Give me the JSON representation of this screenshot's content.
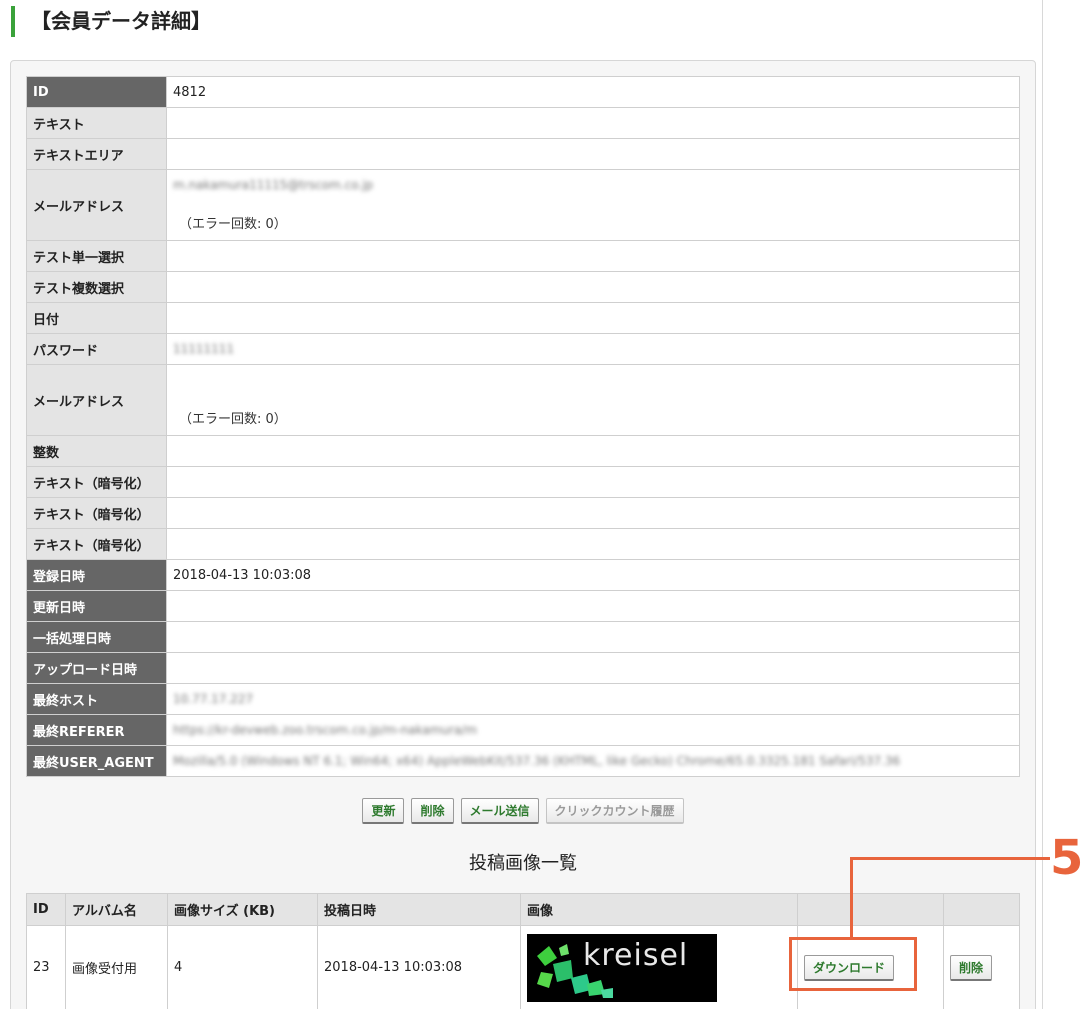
{
  "page": {
    "title": "【会員データ詳細】"
  },
  "detail": {
    "rows": [
      {
        "label": "ID",
        "value": "4812"
      },
      {
        "label": "テキスト",
        "value": ""
      },
      {
        "label": "テキストエリア",
        "value": ""
      },
      {
        "label": "メールアドレス",
        "value": "m.nakamura11115@trscom.co.jp",
        "note": "（エラー回数: 0）"
      },
      {
        "label": "テスト単一選択",
        "value": ""
      },
      {
        "label": "テスト複数選択",
        "value": ""
      },
      {
        "label": "日付",
        "value": ""
      },
      {
        "label": "パスワード",
        "value": "11111111"
      },
      {
        "label": "メールアドレス",
        "value": "",
        "note": "（エラー回数: 0）"
      },
      {
        "label": "整数",
        "value": ""
      },
      {
        "label": "テキスト（暗号化）",
        "value": ""
      },
      {
        "label": "テキスト（暗号化）",
        "value": ""
      },
      {
        "label": "テキスト（暗号化）",
        "value": ""
      },
      {
        "label": "登録日時",
        "value": "2018-04-13 10:03:08"
      },
      {
        "label": "更新日時",
        "value": ""
      },
      {
        "label": "一括処理日時",
        "value": ""
      },
      {
        "label": "アップロード日時",
        "value": ""
      },
      {
        "label": "最終ホスト",
        "value": "10.77.17.227"
      },
      {
        "label": "最終REFERER",
        "value": "https://kr-devweb.zoo.trscom.co.jp/m-nakamura/m"
      },
      {
        "label": "最終USER_AGENT",
        "value": "Mozilla/5.0 (Windows NT 6.1; Win64; x64) AppleWebKit/537.36 (KHTML, like Gecko) Chrome/65.0.3325.181 Safari/537.36"
      }
    ]
  },
  "actions": {
    "update": "更新",
    "delete": "削除",
    "send_mail": "メール送信",
    "click_history": "クリックカウント履歴"
  },
  "images_section": {
    "title": "投稿画像一覧",
    "headers": {
      "id": "ID",
      "album": "アルバム名",
      "size": "画像サイズ (KB)",
      "date": "投稿日時",
      "image": "画像",
      "col6": "",
      "col7": ""
    },
    "row": {
      "id": "23",
      "album": "画像受付用",
      "size": "4",
      "date": "2018-04-13 10:03:08",
      "thumb_text": "kreisel",
      "download": "ダウンロード",
      "delete": "削除"
    }
  },
  "annotation": {
    "number": "5",
    "color": "#e8643c"
  },
  "colors": {
    "accent": "#3aa23a",
    "button_text": "#2e7a2e",
    "dark_header": "#666666"
  }
}
